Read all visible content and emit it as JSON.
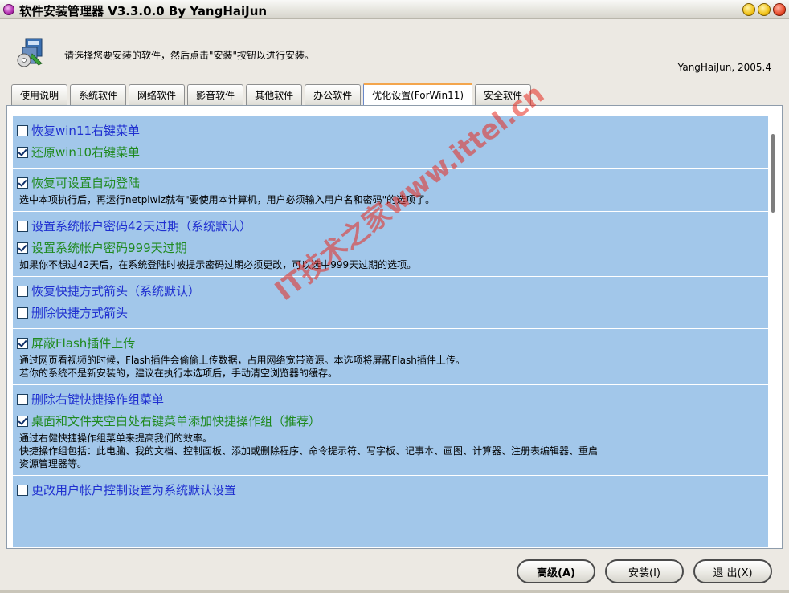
{
  "window": {
    "title": "软件安装管理器 V3.3.0.0 By YangHaiJun"
  },
  "header": {
    "instruction": "请选择您要安装的软件，然后点击\"安装\"按钮以进行安装。",
    "author": "YangHaiJun, 2005.4"
  },
  "tabs": [
    {
      "label": "使用说明"
    },
    {
      "label": "系统软件"
    },
    {
      "label": "网络软件"
    },
    {
      "label": "影音软件"
    },
    {
      "label": "其他软件"
    },
    {
      "label": "办公软件"
    },
    {
      "label": "优化设置(ForWin11)"
    },
    {
      "label": "安全软件"
    }
  ],
  "active_tab": "优化设置(ForWin11)",
  "groups": [
    {
      "options": [
        {
          "label": "恢复win11右键菜单",
          "checked": false
        },
        {
          "label": "还原win10右键菜单",
          "checked": true
        }
      ],
      "desc": []
    },
    {
      "options": [
        {
          "label": "恢复可设置自动登陆",
          "checked": true
        }
      ],
      "desc": [
        "选中本项执行后，再运行netplwiz就有\"要使用本计算机，用户必须输入用户名和密码\"的选项了。"
      ]
    },
    {
      "options": [
        {
          "label": "设置系统帐户密码42天过期（系统默认）",
          "checked": false
        },
        {
          "label": "设置系统帐户密码999天过期",
          "checked": true
        }
      ],
      "desc": [
        "如果你不想过42天后，在系统登陆时被提示密码过期必须更改，可以选中999天过期的选项。"
      ]
    },
    {
      "options": [
        {
          "label": "恢复快捷方式箭头（系统默认）",
          "checked": false
        },
        {
          "label": "删除快捷方式箭头",
          "checked": false
        }
      ],
      "desc": []
    },
    {
      "options": [
        {
          "label": "屏蔽Flash插件上传",
          "checked": true
        }
      ],
      "desc": [
        "通过网页看视频的时候，Flash插件会偷偷上传数据，占用网络宽带资源。本选项将屏蔽Flash插件上传。",
        "若你的系统不是新安装的，建议在执行本选项后，手动清空浏览器的缓存。"
      ]
    },
    {
      "options": [
        {
          "label": "删除右键快捷操作组菜单",
          "checked": false
        },
        {
          "label": "桌面和文件夹空白处右键菜单添加快捷操作组（推荐）",
          "checked": true
        }
      ],
      "desc": [
        "通过右健快捷操作组菜单来提高我们的效率。",
        "快捷操作组包括：此电脑、我的文档、控制面板、添加或删除程序、命令提示符、写字板、记事本、画图、计算器、注册表编辑器、重启",
        "资源管理器等。"
      ]
    },
    {
      "options": [
        {
          "label": "更改用户帐户控制设置为系统默认设置",
          "checked": false
        }
      ],
      "desc": []
    }
  ],
  "watermark": "IT技术之家www.ittel.cn",
  "buttons": {
    "advanced": "高级(A)",
    "install": "安装(I)",
    "exit": "退 出(X)"
  },
  "colors": {
    "list_background": "#a2c7ea",
    "unchecked_label": "#1f2fd0",
    "checked_label": "#1f8a1f",
    "active_tab_accent": "#f3a54c"
  }
}
